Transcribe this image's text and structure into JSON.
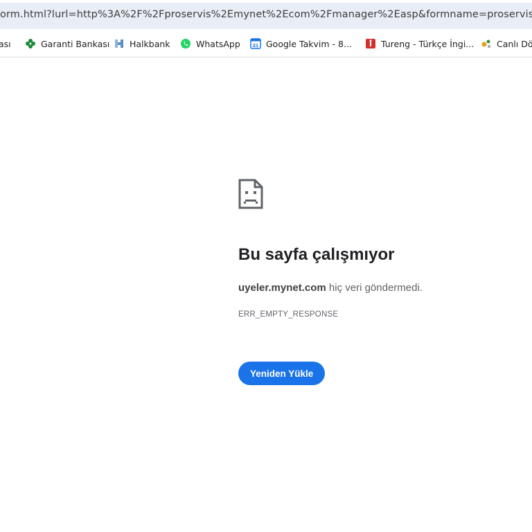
{
  "address_bar": {
    "url": "orm.html?lurl=http%3A%2F%2Fproservis%2Emynet%2Ecom%2Fmanager%2Easp&formname=proservis"
  },
  "bookmarks": [
    {
      "label": "ası",
      "icon": "bookmark-icon"
    },
    {
      "label": "Garanti Bankası",
      "icon": "clover-icon",
      "color": "#1b8a3a"
    },
    {
      "label": "Halkbank",
      "icon": "halkbank-icon",
      "color": "#5a8fc8"
    },
    {
      "label": "WhatsApp",
      "icon": "whatsapp-icon",
      "color": "#25d366"
    },
    {
      "label": "Google Takvim - 8...",
      "icon": "calendar-icon",
      "color": "#1a73e8"
    },
    {
      "label": "Tureng - Türkçe İngi...",
      "icon": "tureng-icon",
      "color": "#d32f2f"
    },
    {
      "label": "Canlı Dö",
      "icon": "currency-icon",
      "color": "#e3a21a"
    }
  ],
  "error": {
    "title": "Bu sayfa çalışmıyor",
    "host": "uyeler.mynet.com",
    "description_suffix": " hiç veri göndermedi.",
    "code": "ERR_EMPTY_RESPONSE",
    "reload_label": "Yeniden Yükle",
    "accent_color": "#1a73e8"
  }
}
